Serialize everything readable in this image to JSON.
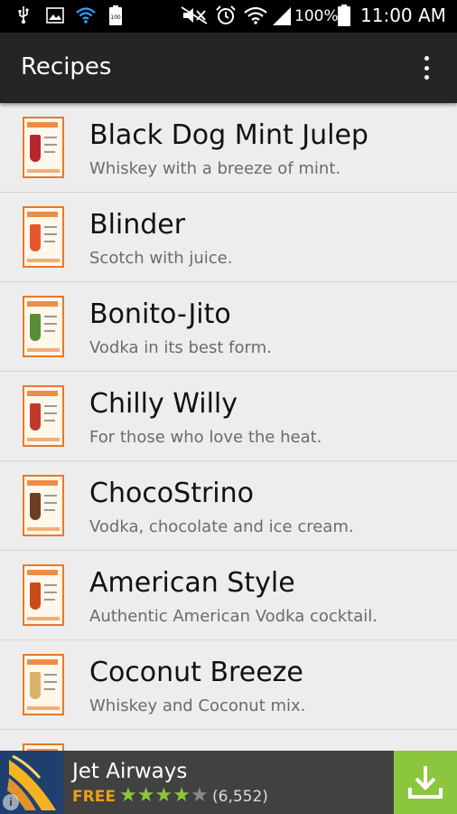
{
  "status_bar": {
    "battery_percent": "100%",
    "time": "11:00 AM",
    "left_icons": [
      "usb-icon",
      "image-icon",
      "wifi-icon",
      "battery-icon"
    ],
    "right_icons": [
      "mute-icon",
      "alarm-icon",
      "wifi-icon",
      "signal-icon",
      "battery-icon"
    ]
  },
  "app_bar": {
    "title": "Recipes",
    "overflow_icon": "more-vert-icon"
  },
  "recipes": [
    {
      "title": "Black Dog Mint Julep",
      "subtitle": "Whiskey with a breeze of mint.",
      "accent": "#b8262e"
    },
    {
      "title": "Blinder",
      "subtitle": "Scotch with juice.",
      "accent": "#e4572e"
    },
    {
      "title": "Bonito-Jito",
      "subtitle": "Vodka in its best form.",
      "accent": "#5b8c3a"
    },
    {
      "title": "Chilly Willy",
      "subtitle": "For those who love the heat.",
      "accent": "#c0392b"
    },
    {
      "title": "ChocoStrino",
      "subtitle": "Vodka, chocolate and ice cream.",
      "accent": "#6b3f1f"
    },
    {
      "title": "American Style",
      "subtitle": "Authentic American Vodka cocktail.",
      "accent": "#c94a1c"
    },
    {
      "title": "Coconut Breeze",
      "subtitle": "Whiskey and Coconut mix.",
      "accent": "#d8b36a"
    },
    {
      "title": "",
      "subtitle": "",
      "accent": "#e4572e"
    }
  ],
  "ad": {
    "app_name": "Jet Airways",
    "price": "FREE",
    "rating": 4,
    "rating_max": 5,
    "review_count": "(6,552)",
    "star_color": "#8cc63f",
    "download_icon": "download-icon",
    "info_icon": "info-icon"
  }
}
